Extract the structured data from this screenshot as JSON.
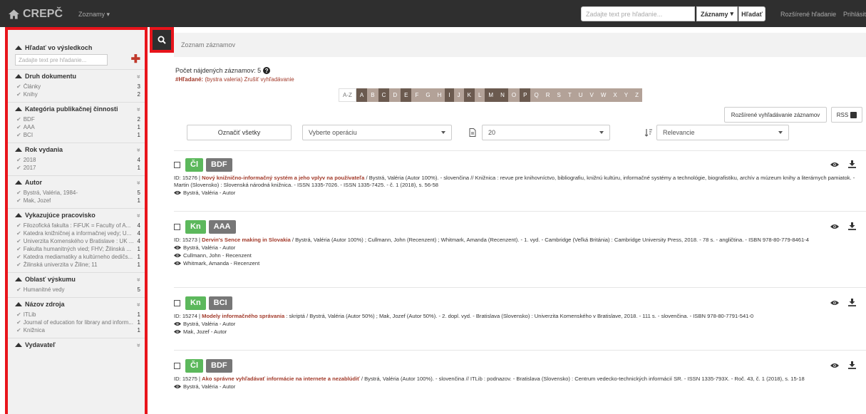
{
  "navbar": {
    "brand": "CREPČ",
    "menu": "Zoznamy ▾",
    "search_placeholder": "Zadajte text pre hľadanie...",
    "select_label": "Záznamy",
    "search_button": "Hľadať",
    "advanced_link": "Rozšírené hľadanie",
    "login_link": "Prihlásiť"
  },
  "sidebar": {
    "title": "Hľadať vo výsledkoch",
    "search_placeholder": "Zadajte text pre hľadanie...",
    "groups": [
      {
        "title": "Druh dokumentu",
        "items": [
          {
            "label": "Články",
            "count": "3"
          },
          {
            "label": "Knihy",
            "count": "2"
          }
        ]
      },
      {
        "title": "Kategória publikačnej činnosti",
        "items": [
          {
            "label": "BDF",
            "count": "2"
          },
          {
            "label": "AAA",
            "count": "1"
          },
          {
            "label": "BCI",
            "count": "1"
          }
        ]
      },
      {
        "title": "Rok vydania",
        "items": [
          {
            "label": "2018",
            "count": "4"
          },
          {
            "label": "2017",
            "count": "1"
          }
        ]
      },
      {
        "title": "Autor",
        "items": [
          {
            "label": "Bystrá, Valéria, 1984-",
            "count": "5"
          },
          {
            "label": "Mak, Jozef",
            "count": "1"
          }
        ]
      },
      {
        "title": "Vykazujúce pracovisko",
        "items": [
          {
            "label": "Filozofická fakulta : FiFUK = Faculty of A...",
            "count": "4"
          },
          {
            "label": "Katedra knižničnej a informačnej vedy; U...",
            "count": "4"
          },
          {
            "label": "Univerzita Komenského v Bratislave : UK ...",
            "count": "4"
          },
          {
            "label": "Fakulta humanitných vied; FHV; Žilinská ...",
            "count": "1"
          },
          {
            "label": "Katedra mediamatiky a kultúrneho dedičs...",
            "count": "1"
          },
          {
            "label": "Žilinská univerzita v Žiline; 11",
            "count": "1"
          }
        ]
      },
      {
        "title": "Oblasť výskumu",
        "items": [
          {
            "label": "Humanitné vedy",
            "count": "5"
          }
        ]
      },
      {
        "title": "Názov zdroja",
        "items": [
          {
            "label": "ITLib",
            "count": "1"
          },
          {
            "label": "Journal of education for library and inform...",
            "count": "1"
          },
          {
            "label": "Knižnica",
            "count": "1"
          }
        ]
      },
      {
        "title": "Vydavateľ",
        "items": []
      }
    ]
  },
  "breadcrumb": "Zoznam záznamov",
  "results": {
    "count_label": "Počet nájdených záznamov: 5",
    "query_label": "#Hľadané:",
    "query_value": "(bystra valeria)",
    "query_clear": "Zrušiť vyhľadávanie",
    "alphabet": [
      "A-Z",
      "A",
      "B",
      "C",
      "D",
      "E",
      "F",
      "G",
      "H",
      "I",
      "J",
      "K",
      "L",
      "M",
      "N",
      "O",
      "P",
      "Q",
      "R",
      "S",
      "T",
      "U",
      "V",
      "W",
      "X",
      "Y",
      "Z"
    ],
    "advanced_button": "Rozšírené vyhľadávanie záznamov",
    "rss_button": "RSS",
    "mark_all": "Označiť všetky",
    "operation_select": "Vyberte operáciu",
    "per_page_select": "20",
    "sort_select": "Relevancie"
  },
  "records": [
    {
      "type_badge": "Čl",
      "category_badge": "BDF",
      "id_prefix": "ID: 15276 | ",
      "title": "Nový knižnično-informačný systém a jeho vplyv na používateľa",
      "rest": " / Bystrá, Valéria (Autor 100%). - slovenčina // Knižnica : revue pre knihovníctvo, bibliografiu, knižnú kultúru, informačné systémy a technológie, biografistiku, archív a múzeum knihy a literárnych pamiatok. - Martin (Slovensko) : Slovenská národná knižnica. - ISSN 1335-7026. - ISSN 1335-7425. - č. 1 (2018), s. 56-58",
      "authors": [
        "Bystrá, Valéria - Autor"
      ]
    },
    {
      "type_badge": "Kn",
      "category_badge": "AAA",
      "id_prefix": "ID: 15273 | ",
      "title": "Dervin's Sence making in Slovakia",
      "rest": " / Bystrá, Valéria (Autor 100%) ; Cullmann, John (Recenzent) ; Whitmark, Amanda (Recenzent). - 1. vyd. - Cambridge (Veľká Británia) : Cambridge University Press, 2018. - 78 s. - angličtina. - ISBN 978-80-779-8461-4",
      "authors": [
        "Bystrá, Valéria - Autor",
        "Cullmann, John - Recenzent",
        "Whitmark, Amanda - Recenzent"
      ]
    },
    {
      "type_badge": "Kn",
      "category_badge": "BCI",
      "id_prefix": "ID: 15274 | ",
      "title": "Modely informačného správania",
      "rest": " : skriptá / Bystrá, Valéria (Autor 50%) ; Mak, Jozef (Autor 50%). - 2. dopl. vyd. - Bratislava (Slovensko) : Univerzita Komenského v Bratislave, 2018. - 111 s. - slovenčina. - ISBN 978-80-7791-541-0",
      "authors": [
        "Bystrá, Valéria - Autor",
        "Mak, Jozef - Autor"
      ]
    },
    {
      "type_badge": "Čl",
      "category_badge": "BDF",
      "id_prefix": "ID: 15275 | ",
      "title": "Ako správne vyhľadávať informácie na internete a nezablúdiť",
      "rest": " / Bystrá, Valéria (Autor 100%). - slovenčina // ITLib : podnazov. - Bratislava (Slovensko) : Centrum vedecko-technických informácií SR. - ISSN 1335-793X. - Roč. 43, č. 1 (2018), s. 15-18",
      "authors": [
        "Bystrá, Valéria - Autor"
      ]
    }
  ],
  "colors": {
    "navbar": "#2f2f2f",
    "highlight": "#e8141b",
    "link": "#a23a2a",
    "badge_green": "#5cb85c",
    "badge_gray": "#777777"
  }
}
